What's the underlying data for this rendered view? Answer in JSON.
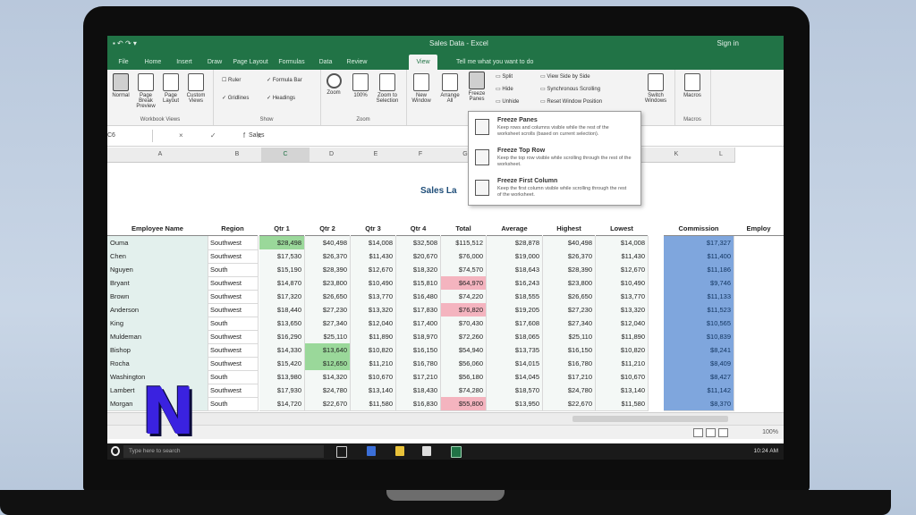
{
  "window": {
    "quick_access": "▪ ↶ ↷ ▾",
    "title": "Sales Data - Excel",
    "user": "Sign in"
  },
  "ribbon_tabs": [
    "File",
    "Home",
    "Insert",
    "Draw",
    "Page Layout",
    "Formulas",
    "Data",
    "Review",
    "View"
  ],
  "active_tab": "View",
  "tell_me": "Tell me what you want to do",
  "ribbon": {
    "workbook_views": {
      "label": "Workbook Views",
      "buttons": [
        "Normal",
        "Page Break Preview",
        "Page Layout",
        "Custom Views"
      ]
    },
    "show": {
      "label": "Show",
      "items": [
        "Ruler",
        "Formula Bar",
        "Gridlines",
        "Headings"
      ]
    },
    "zoom": {
      "label": "Zoom",
      "buttons": [
        "Zoom",
        "100%",
        "Zoom to Selection"
      ]
    },
    "window": {
      "label": "Window",
      "buttons": [
        "New Window",
        "Arrange All",
        "Freeze Panes"
      ],
      "small": [
        "Split",
        "Hide",
        "Unhide"
      ],
      "side": [
        "View Side by Side",
        "Synchronous Scrolling",
        "Reset Window Position"
      ],
      "switch": "Switch Windows"
    },
    "macros": {
      "label": "Macros",
      "button": "Macros"
    }
  },
  "freeze_menu": [
    {
      "title": "Freeze Panes",
      "desc": "Keep rows and columns visible while the rest of the worksheet scrolls (based on current selection)."
    },
    {
      "title": "Freeze Top Row",
      "desc": "Keep the top row visible while scrolling through the rest of the worksheet."
    },
    {
      "title": "Freeze First Column",
      "desc": "Keep the first column visible while scrolling through the rest of the worksheet."
    }
  ],
  "formula_bar": {
    "name_box": "C6",
    "icons": "× ✓ fx",
    "value": "Sales"
  },
  "columns": [
    "A",
    "B",
    "C",
    "D",
    "E",
    "F",
    "G",
    "H",
    "I",
    "J",
    "K",
    "L"
  ],
  "selected_column": "C",
  "sheet_title": "Sales La",
  "headers": [
    "Employee Name",
    "Region",
    "Qtr 1",
    "Qtr 2",
    "Qtr 3",
    "Qtr 4",
    "Total",
    "Average",
    "Highest",
    "Lowest",
    "Commission",
    "Employ"
  ],
  "rows": [
    {
      "name": "Ouma",
      "region": "Southwest",
      "q1": "$28,498",
      "q2": "$40,498",
      "q3": "$14,008",
      "q4": "$32,508",
      "total": "$115,512",
      "avg": "$28,878",
      "high": "$40,498",
      "low": "$14,008",
      "comm": "$17,327"
    },
    {
      "name": "Chen",
      "region": "Southwest",
      "q1": "$17,530",
      "q2": "$26,370",
      "q3": "$11,430",
      "q4": "$20,670",
      "total": "$76,000",
      "avg": "$19,000",
      "high": "$26,370",
      "low": "$11,430",
      "comm": "$11,400"
    },
    {
      "name": "Nguyen",
      "region": "South",
      "q1": "$15,190",
      "q2": "$28,390",
      "q3": "$12,670",
      "q4": "$18,320",
      "total": "$74,570",
      "avg": "$18,643",
      "high": "$28,390",
      "low": "$12,670",
      "comm": "$11,186"
    },
    {
      "name": "Bryant",
      "region": "Southwest",
      "q1": "$14,870",
      "q2": "$23,800",
      "q3": "$10,490",
      "q4": "$15,810",
      "total": "$64,970",
      "avg": "$16,243",
      "high": "$23,800",
      "low": "$10,490",
      "comm": "$9,746"
    },
    {
      "name": "Brown",
      "region": "Southwest",
      "q1": "$17,320",
      "q2": "$26,650",
      "q3": "$13,770",
      "q4": "$16,480",
      "total": "$74,220",
      "avg": "$18,555",
      "high": "$26,650",
      "low": "$13,770",
      "comm": "$11,133"
    },
    {
      "name": "Anderson",
      "region": "Southwest",
      "q1": "$18,440",
      "q2": "$27,230",
      "q3": "$13,320",
      "q4": "$17,830",
      "total": "$76,820",
      "avg": "$19,205",
      "high": "$27,230",
      "low": "$13,320",
      "comm": "$11,523"
    },
    {
      "name": "King",
      "region": "South",
      "q1": "$13,650",
      "q2": "$27,340",
      "q3": "$12,040",
      "q4": "$17,400",
      "total": "$70,430",
      "avg": "$17,608",
      "high": "$27,340",
      "low": "$12,040",
      "comm": "$10,565"
    },
    {
      "name": "Muldeman",
      "region": "Southwest",
      "q1": "$16,290",
      "q2": "$25,110",
      "q3": "$11,890",
      "q4": "$18,970",
      "total": "$72,260",
      "avg": "$18,065",
      "high": "$25,110",
      "low": "$11,890",
      "comm": "$10,839"
    },
    {
      "name": "Bishop",
      "region": "Southwest",
      "q1": "$14,330",
      "q2": "$13,640",
      "q3": "$10,820",
      "q4": "$16,150",
      "total": "$54,940",
      "avg": "$13,735",
      "high": "$16,150",
      "low": "$10,820",
      "comm": "$8,241"
    },
    {
      "name": "Rocha",
      "region": "Southwest",
      "q1": "$15,420",
      "q2": "$12,650",
      "q3": "$11,210",
      "q4": "$16,780",
      "total": "$56,060",
      "avg": "$14,015",
      "high": "$16,780",
      "low": "$11,210",
      "comm": "$8,409"
    },
    {
      "name": "Washington",
      "region": "South",
      "q1": "$13,980",
      "q2": "$14,320",
      "q3": "$10,670",
      "q4": "$17,210",
      "total": "$56,180",
      "avg": "$14,045",
      "high": "$17,210",
      "low": "$10,670",
      "comm": "$8,427"
    },
    {
      "name": "Lambert",
      "region": "Southwest",
      "q1": "$17,930",
      "q2": "$24,780",
      "q3": "$13,140",
      "q4": "$18,430",
      "total": "$74,280",
      "avg": "$18,570",
      "high": "$24,780",
      "low": "$13,140",
      "comm": "$11,142"
    },
    {
      "name": "Morgan",
      "region": "South",
      "q1": "$14,720",
      "q2": "$22,670",
      "q3": "$11,580",
      "q4": "$16,830",
      "total": "$55,800",
      "avg": "$13,950",
      "high": "$22,670",
      "low": "$11,580",
      "comm": "$8,370"
    }
  ],
  "highlights": {
    "green": [
      [
        0,
        "q1"
      ],
      [
        8,
        "q2"
      ],
      [
        9,
        "q2"
      ]
    ],
    "red": [
      [
        3,
        "total"
      ],
      [
        5,
        "total"
      ],
      [
        12,
        "total"
      ]
    ]
  },
  "taskbar": {
    "search_placeholder": "Type here to search",
    "clock": "10:24 AM"
  },
  "status": {
    "zoom": "100%"
  },
  "colors": {
    "excel_green": "#217346",
    "commission_blue": "#7fa6dd",
    "logo": "#3a22e0"
  },
  "logo_letter": "N"
}
